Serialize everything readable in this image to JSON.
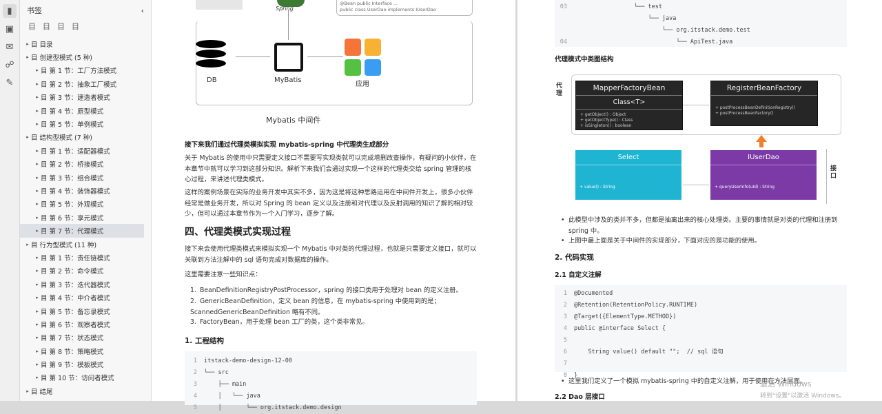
{
  "bookmark_panel": {
    "title": "书签",
    "tools": [
      "目",
      "目",
      "目",
      "目"
    ]
  },
  "outline": [
    {
      "label": "目 目录",
      "level": 0
    },
    {
      "label": "目 创建型模式 (5 种)",
      "level": 0
    },
    {
      "label": "目 第 1 节：工厂方法模式",
      "level": 1
    },
    {
      "label": "目 第 2 节：抽象工厂模式",
      "level": 1
    },
    {
      "label": "目 第 3 节：建造者模式",
      "level": 1
    },
    {
      "label": "目 第 4 节：原型模式",
      "level": 1
    },
    {
      "label": "目 第 5 节：单例模式",
      "level": 1
    },
    {
      "label": "目 结构型模式 (7 种)",
      "level": 0
    },
    {
      "label": "目 第 1 节：适配器模式",
      "level": 1
    },
    {
      "label": "目 第 2 节：桥接模式",
      "level": 1
    },
    {
      "label": "目 第 3 节：组合模式",
      "level": 1
    },
    {
      "label": "目 第 4 节：装饰器模式",
      "level": 1
    },
    {
      "label": "目 第 5 节：外观模式",
      "level": 1
    },
    {
      "label": "目 第 6 节：享元模式",
      "level": 1
    },
    {
      "label": "目 第 7 节：代理模式",
      "level": 1,
      "selected": true
    },
    {
      "label": "目 行为型模式 (11 种)",
      "level": 0
    },
    {
      "label": "目 第 1 节：责任链模式",
      "level": 1
    },
    {
      "label": "目 第 2 节：命令模式",
      "level": 1
    },
    {
      "label": "目 第 3 节：迭代器模式",
      "level": 1
    },
    {
      "label": "目 第 4 节：中介者模式",
      "level": 1
    },
    {
      "label": "目 第 5 节：备忘录模式",
      "level": 1
    },
    {
      "label": "目 第 6 节：观察者模式",
      "level": 1
    },
    {
      "label": "目 第 7 节：状态模式",
      "level": 1
    },
    {
      "label": "目 第 8 节：策略模式",
      "level": 1
    },
    {
      "label": "目 第 9 节：模板模式",
      "level": 1
    },
    {
      "label": "目 第 10 节：访问者模式",
      "level": 1
    },
    {
      "label": "目 结尾",
      "level": 0
    }
  ],
  "pageA": {
    "spring_label": "Spring",
    "note_line1": "@Bean public Interface ...",
    "note_line2": "public class UserDao implements IUserDao",
    "db_label": "DB",
    "mybatis_label": "MyBatis",
    "app_label": "应用",
    "diagram_caption": "Mybatis 中间件",
    "section_heading": "接下来我们通过代理类模拟实现 mybatis-spring 中代理类生成部分",
    "para1": "关于 Mybatis 的使用中只需要定义接口不需要写实现类就可以完成增删改查操作，有疑问的小伙伴，在本章节中就可以学习到这部分知识。解析下来我们会通过实现一个这样的代理类交给 spring 管理的核心过程，来讲述代理类模式。",
    "para2": "这样的案例场景在实际的业务开发中其实不多，因为这是将这种思路运用在中间件开发上，很多小伙伴经常是做业务开发，所以对 Spring 的 bean 定义以及注册和对代理以及反射调用的知识了解的相对较少，但可以通过本章节作为一个入门学习，逐步了解。",
    "h2": "四、代理类模式实现过程",
    "para3": "接下来会使用代理类模式来模拟实现一个 Mybatis 中对类的代理过程，也就是只需要定义接口，就可以关联到方法注解中的 sql 语句完成对数据库的操作。",
    "para4": "这里需要注意一些知识点：",
    "list": [
      "BeanDefinitionRegistryPostProcessor，spring 的接口类用于处理对 bean 的定义注册。",
      "GenericBeanDefinition，定义 bean 的信息，在 mybatis-spring 中使用到的是；ScannedGenericBeanDefinition 略有不同。",
      "FactoryBean，用于处理 bean 工厂的类，这个类非常见。"
    ],
    "h3": "1. 工程结构",
    "code": [
      "itstack-demo-design-12-00",
      "└── src",
      "    ├── main",
      "    │   └── java",
      "    │       └── org.itstack.demo.design"
    ]
  },
  "pageB": {
    "code": [
      "                 └── test",
      "                     └── java",
      "                         └── org.itstack.demo.test",
      "                             └── ApiTest.java"
    ],
    "code_ln": [
      "03",
      "",
      "",
      "04"
    ],
    "section_heading": "代理模式中类图结构",
    "side_label_left": "代理",
    "side_label_right": "接口",
    "card1_title": "MapperFactoryBean",
    "card1_sub": "Class<T>",
    "card1_body": [
      "+ getObject() : Object",
      "+ getObjectType() : Class",
      "+ isSingleton() : boolean"
    ],
    "card2_title": "RegisterBeanFactory",
    "card2_body": [
      "+ postProcessBeanDefinitionRegistry()",
      "+ postProcessBeanFactory()"
    ],
    "card3_title": "Select",
    "card3_body": "+ value() : String",
    "card4_title": "IUserDao",
    "card4_body": "+ queryUserInfo(uId) : String",
    "bullet1": "此模型中涉及的类并不多，但都是抽离出来的核心处理类。主要的事情就是对类的代理和注册到 spring 中。",
    "bullet2": "上图中最上面是关于中间件的实现部分，下面对应的是功能的使用。",
    "h3_impl": "2. 代码实现",
    "h3_sub": "2.1 自定义注解",
    "code2": [
      "@Documented",
      "@Retention(RetentionPolicy.RUNTIME)",
      "@Target({ElementType.METHOD})",
      "public @interface Select {",
      "",
      "    String value() default \"\";  // sql 语句",
      "",
      "}"
    ],
    "bullet3": "这里我们定义了一个模拟 mybatis-spring 中的自定义注解，用于使用在方法层面。",
    "h3_next": "2.2 Dao 层接口",
    "watermark1": "激活 Windows",
    "watermark2": "转到\"设置\"以激活 Windows。"
  },
  "colors": {
    "cyan_card": "#1fb5d2",
    "purple_card": "#7b3aa5",
    "arrow": "#f07f2b",
    "app_tiles": [
      "#f4743a",
      "#f8b233",
      "#55c143",
      "#3a9df2"
    ]
  }
}
